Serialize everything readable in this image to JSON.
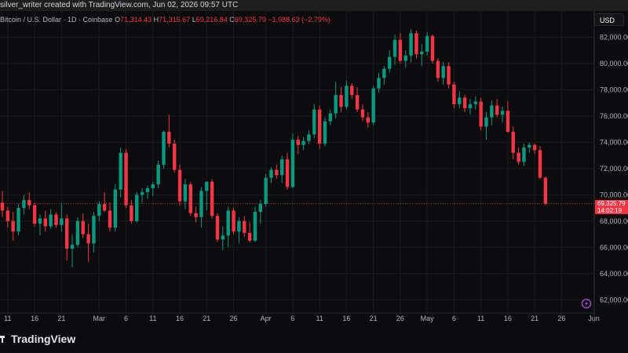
{
  "header": {
    "caption": "silver_writer created with TradingView.com, Jun 02, 2026 09:57 UTC"
  },
  "legend": {
    "symbol": "Bitcoin / U.S. Dollar · 1D · Coinbase",
    "open_label": "O",
    "open": "71,314.43",
    "high_label": "H",
    "high": "71,315.67",
    "low_label": "L",
    "low": "69,216.84",
    "close_label": "C",
    "close": "69,325.79",
    "change": "−1,988.63 (−2.79%)"
  },
  "currency_button": "USD",
  "price_tag": {
    "price": "69,325.79",
    "countdown": "14:02:19"
  },
  "brand": "TradingView",
  "colors": {
    "up": "#089981",
    "down": "#f23645",
    "background": "#0c0c0e",
    "grid": "#1c1c20"
  },
  "chart_data": {
    "type": "candlestick",
    "title": "Bitcoin / U.S. Dollar · 1D · Coinbase",
    "grid": true,
    "ylim": [
      61000,
      84000
    ],
    "y_ticks": [
      "62,000.00",
      "64,000.00",
      "66,000.00",
      "68,000.00",
      "70,000.00",
      "72,000.00",
      "74,000.00",
      "76,000.00",
      "78,000.00",
      "80,000.00",
      "82,000.00"
    ],
    "x_ticks": [
      {
        "label": "11",
        "index": 1
      },
      {
        "label": "16",
        "index": 6
      },
      {
        "label": "21",
        "index": 11
      },
      {
        "label": "Mar",
        "index": 18
      },
      {
        "label": "6",
        "index": 23
      },
      {
        "label": "11",
        "index": 28
      },
      {
        "label": "16",
        "index": 33
      },
      {
        "label": "21",
        "index": 38
      },
      {
        "label": "26",
        "index": 43
      },
      {
        "label": "Apr",
        "index": 49
      },
      {
        "label": "6",
        "index": 54
      },
      {
        "label": "11",
        "index": 59
      },
      {
        "label": "16",
        "index": 64
      },
      {
        "label": "21",
        "index": 69
      },
      {
        "label": "26",
        "index": 74
      },
      {
        "label": "May",
        "index": 79
      },
      {
        "label": "6",
        "index": 84
      },
      {
        "label": "11",
        "index": 89
      },
      {
        "label": "16",
        "index": 94
      },
      {
        "label": "21",
        "index": 99
      },
      {
        "label": "26",
        "index": 104
      },
      {
        "label": "Jun",
        "index": 110
      }
    ],
    "last_price": 69325.79,
    "candles": [
      [
        69400,
        70300,
        68300,
        68800
      ],
      [
        68800,
        69100,
        67500,
        68000
      ],
      [
        68000,
        68700,
        66500,
        67200
      ],
      [
        67200,
        69300,
        66900,
        69000
      ],
      [
        69000,
        70000,
        68500,
        69600
      ],
      [
        69600,
        70200,
        68900,
        69200
      ],
      [
        69200,
        69400,
        67600,
        67800
      ],
      [
        67800,
        68500,
        66900,
        68200
      ],
      [
        68200,
        68800,
        67200,
        67600
      ],
      [
        67600,
        68900,
        67400,
        68500
      ],
      [
        68500,
        68700,
        67500,
        67700
      ],
      [
        67700,
        69400,
        67200,
        68200
      ],
      [
        68200,
        68500,
        65000,
        65900
      ],
      [
        65900,
        67000,
        64500,
        66200
      ],
      [
        66200,
        68300,
        66000,
        68000
      ],
      [
        68000,
        68600,
        66700,
        67000
      ],
      [
        67000,
        67800,
        64900,
        66300
      ],
      [
        66300,
        68700,
        65600,
        68400
      ],
      [
        68400,
        69500,
        68000,
        69300
      ],
      [
        69300,
        70200,
        68700,
        68800
      ],
      [
        68800,
        69400,
        67200,
        67500
      ],
      [
        67500,
        70800,
        67200,
        70400
      ],
      [
        70400,
        73600,
        69800,
        73200
      ],
      [
        73200,
        73500,
        69000,
        69200
      ],
      [
        69200,
        69600,
        67800,
        68000
      ],
      [
        68000,
        70200,
        67900,
        70000
      ],
      [
        70000,
        70500,
        69400,
        70200
      ],
      [
        70200,
        70700,
        69700,
        70500
      ],
      [
        70500,
        71000,
        69900,
        70800
      ],
      [
        70800,
        72600,
        70500,
        72300
      ],
      [
        72300,
        74900,
        72000,
        74800
      ],
      [
        74800,
        76100,
        73600,
        73900
      ],
      [
        73900,
        74200,
        71700,
        71900
      ],
      [
        71900,
        72300,
        69200,
        69500
      ],
      [
        69500,
        71200,
        68900,
        70800
      ],
      [
        70800,
        71000,
        68400,
        68600
      ],
      [
        68600,
        69100,
        67900,
        68300
      ],
      [
        68300,
        70600,
        67500,
        70300
      ],
      [
        70300,
        71000,
        68800,
        71000
      ],
      [
        71000,
        71200,
        68200,
        68400
      ],
      [
        68400,
        68600,
        66400,
        66600
      ],
      [
        66600,
        67600,
        65800,
        66900
      ],
      [
        66900,
        69100,
        66000,
        68800
      ],
      [
        68800,
        69000,
        67000,
        67200
      ],
      [
        67200,
        68300,
        66300,
        68000
      ],
      [
        68000,
        68400,
        66800,
        67100
      ],
      [
        67100,
        67900,
        66400,
        66500
      ],
      [
        66500,
        69100,
        66400,
        68700
      ],
      [
        68700,
        69600,
        67800,
        69300
      ],
      [
        69300,
        71600,
        69100,
        71300
      ],
      [
        71300,
        72100,
        70900,
        71900
      ],
      [
        71900,
        72300,
        71200,
        71500
      ],
      [
        71500,
        73000,
        70900,
        72700
      ],
      [
        72700,
        73200,
        70400,
        70600
      ],
      [
        70600,
        74700,
        70500,
        74200
      ],
      [
        74200,
        74500,
        73100,
        73800
      ],
      [
        73800,
        74400,
        73400,
        74100
      ],
      [
        74100,
        74900,
        73900,
        74600
      ],
      [
        74600,
        76900,
        74300,
        76500
      ],
      [
        76500,
        76800,
        73500,
        73900
      ],
      [
        73900,
        75900,
        73700,
        75600
      ],
      [
        75600,
        76500,
        75300,
        76200
      ],
      [
        76200,
        78600,
        75800,
        77600
      ],
      [
        77600,
        78200,
        76300,
        76700
      ],
      [
        76700,
        78700,
        76500,
        78300
      ],
      [
        78300,
        78500,
        77300,
        77600
      ],
      [
        77600,
        78200,
        76300,
        76500
      ],
      [
        76500,
        76900,
        75600,
        75900
      ],
      [
        75900,
        76300,
        75100,
        75500
      ],
      [
        75500,
        78300,
        75300,
        78100
      ],
      [
        78100,
        79300,
        77800,
        78900
      ],
      [
        78900,
        79800,
        78400,
        79600
      ],
      [
        79600,
        81000,
        79300,
        80500
      ],
      [
        80500,
        82200,
        79900,
        81800
      ],
      [
        81800,
        82300,
        80000,
        80200
      ],
      [
        80200,
        81000,
        79700,
        80600
      ],
      [
        80600,
        82600,
        80100,
        82300
      ],
      [
        82300,
        82500,
        80400,
        80700
      ],
      [
        80700,
        81500,
        79800,
        80900
      ],
      [
        80900,
        82400,
        80600,
        82100
      ],
      [
        82100,
        82200,
        80000,
        80200
      ],
      [
        80200,
        80400,
        78600,
        78900
      ],
      [
        78900,
        80100,
        78400,
        79800
      ],
      [
        79800,
        80100,
        78100,
        78400
      ],
      [
        78400,
        78600,
        76600,
        76900
      ],
      [
        76900,
        77900,
        76600,
        77400
      ],
      [
        77400,
        77600,
        76300,
        76600
      ],
      [
        76600,
        77300,
        76100,
        76900
      ],
      [
        76900,
        77500,
        76500,
        77100
      ],
      [
        77100,
        77400,
        74900,
        75200
      ],
      [
        75200,
        76300,
        74200,
        75900
      ],
      [
        75900,
        77200,
        75300,
        76800
      ],
      [
        76800,
        77300,
        75900,
        76100
      ],
      [
        76100,
        76700,
        75500,
        76400
      ],
      [
        76400,
        77100,
        74700,
        74800
      ],
      [
        74800,
        75200,
        72700,
        73200
      ],
      [
        73200,
        73600,
        72300,
        72500
      ],
      [
        72500,
        73900,
        72200,
        73600
      ],
      [
        73600,
        74000,
        73200,
        73800
      ],
      [
        73800,
        73900,
        73100,
        73400
      ],
      [
        73400,
        73700,
        71200,
        71300
      ],
      [
        71300,
        71400,
        69200,
        69330
      ]
    ]
  }
}
